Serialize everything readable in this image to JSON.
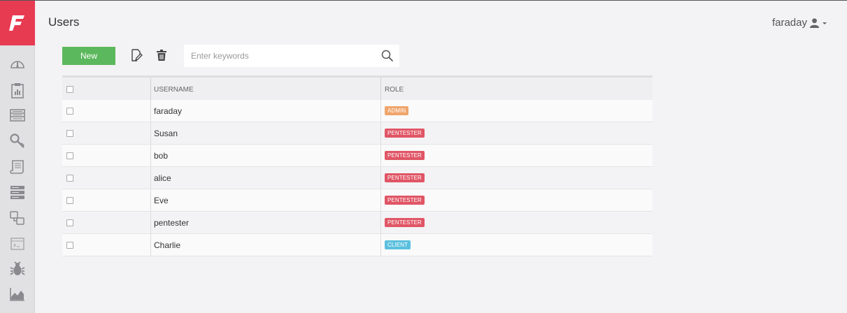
{
  "header": {
    "title": "Users",
    "username": "faraday"
  },
  "logo": {
    "letter": "F"
  },
  "sidebar": {
    "items": [
      {
        "name": "dashboard",
        "icon": "gauge-icon"
      },
      {
        "name": "status-report",
        "icon": "clipboard-icon"
      },
      {
        "name": "hosts",
        "icon": "list-icon"
      },
      {
        "name": "credentials",
        "icon": "key-icon"
      },
      {
        "name": "executive-report",
        "icon": "report-icon"
      },
      {
        "name": "workspaces",
        "icon": "server-icon"
      },
      {
        "name": "communication",
        "icon": "chat-icon"
      },
      {
        "name": "commands",
        "icon": "terminal-icon"
      },
      {
        "name": "vulnerabilities",
        "icon": "bug-icon"
      },
      {
        "name": "analytics",
        "icon": "chart-icon"
      }
    ]
  },
  "toolbar": {
    "new_label": "New",
    "search_placeholder": "Enter keywords"
  },
  "table": {
    "columns": {
      "username": "USERNAME",
      "role": "ROLE"
    },
    "rows": [
      {
        "username": "faraday",
        "role": "ADMIN",
        "color": "#f0a56c"
      },
      {
        "username": "Susan",
        "role": "PENTESTER",
        "color": "#e05565"
      },
      {
        "username": "bob",
        "role": "PENTESTER",
        "color": "#e05565"
      },
      {
        "username": "alice",
        "role": "PENTESTER",
        "color": "#e05565"
      },
      {
        "username": "Eve",
        "role": "PENTESTER",
        "color": "#e05565"
      },
      {
        "username": "pentester",
        "role": "PENTESTER",
        "color": "#e05565"
      },
      {
        "username": "Charlie",
        "role": "CLIENT",
        "color": "#5bc0de"
      }
    ]
  },
  "colors": {
    "brand": "#e73b52",
    "new_button": "#5cb85c"
  }
}
